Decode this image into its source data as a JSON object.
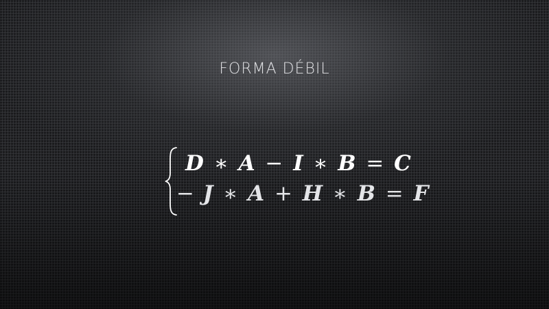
{
  "slide": {
    "title": "Forma débil",
    "equations": [
      {
        "terms": [
          "D",
          "∗",
          "A",
          "−",
          "I",
          "∗",
          "B",
          "=",
          "C"
        ]
      },
      {
        "terms": [
          "−",
          "J",
          "∗",
          "A",
          "+",
          "H",
          "∗",
          "B",
          "=",
          "F"
        ]
      }
    ],
    "brace_icon": "left-curly-brace-icon",
    "colors": {
      "background": "#2a2b2e",
      "title": "#e2e3e6",
      "equation_text": "#ffffff"
    }
  }
}
